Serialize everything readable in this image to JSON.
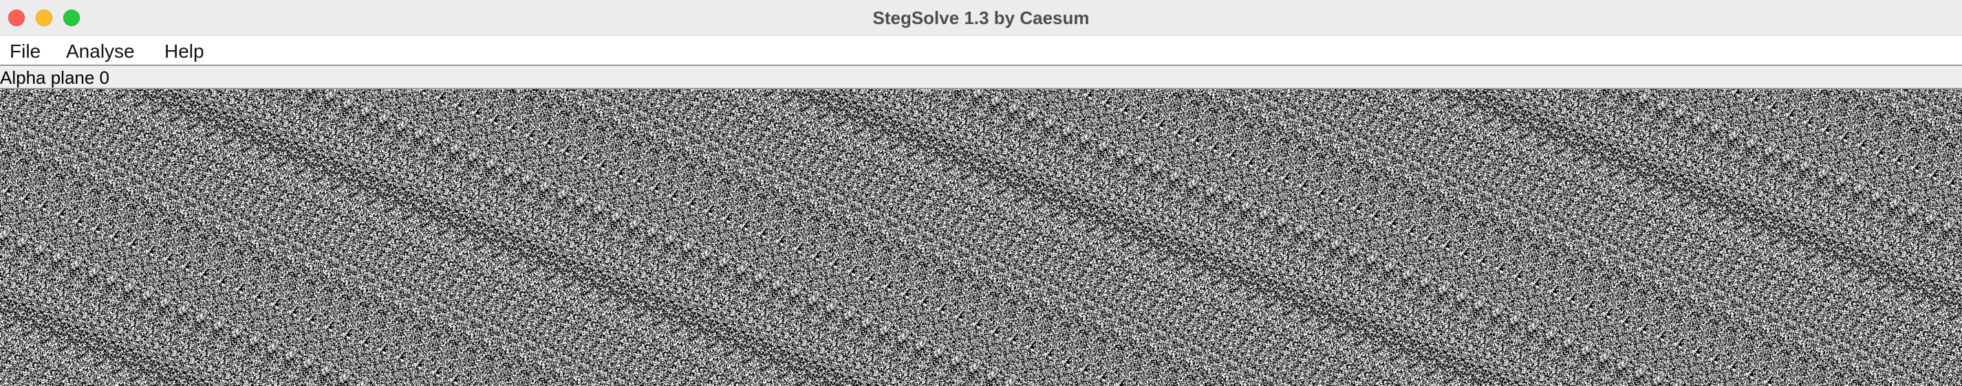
{
  "window": {
    "title": "StegSolve 1.3 by Caesum",
    "controls": {
      "close_color": "#ff5f57",
      "minimize_color": "#febc2e",
      "zoom_color": "#28c840"
    }
  },
  "menu": {
    "items": [
      {
        "label": "File"
      },
      {
        "label": "Analyse"
      },
      {
        "label": "Help"
      }
    ]
  },
  "status": {
    "label": "Alpha plane 0"
  },
  "image": {
    "description_kind": "random bit-plane noise",
    "foreground_color": "#000000",
    "background_color": "#ffffff"
  }
}
